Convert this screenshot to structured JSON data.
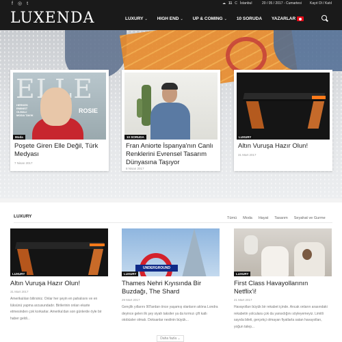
{
  "topbar": {
    "social": [
      "f",
      "◎",
      "t"
    ],
    "weather": {
      "temp": "11",
      "unit": "C",
      "city": "İstanbul"
    },
    "date": "20 / 05 / 2017 - Cumartesi",
    "auth": "Kayıt Ol / Katıl"
  },
  "nav": {
    "logo": "LUXENDA",
    "items": [
      {
        "label": "LUXURY",
        "has_dropdown": true
      },
      {
        "label": "HIGH END",
        "has_dropdown": true
      },
      {
        "label": "UP & COMING",
        "has_dropdown": true
      },
      {
        "label": "10 SORUDA",
        "has_dropdown": false
      },
      {
        "label": "YAZARLAR",
        "has_dropdown": true
      }
    ],
    "chevron": "⌄",
    "flag": "turkey-flag",
    "search_icon": "search-icon"
  },
  "hero": {
    "cards": [
      {
        "category": "Moda",
        "title": "Poşete Giren Elle Değil, Türk Medyası",
        "date": "7 Nisan 2017",
        "cover_left": "HERKES EMINIST OLMALI MODA TAVIK",
        "cover_right": "ROSIE"
      },
      {
        "category": "10 SORUDA",
        "title": "Fran Aniorte İspanya'nın Canlı Renklerini Evrensel Tasarım Dünyasına Taşıyor",
        "date": "8 Nisan 2017"
      },
      {
        "category": "LUXURY",
        "title": "Altın Vuruşa Hazır Olun!",
        "date": "31 Mart 2017"
      }
    ]
  },
  "section": {
    "title": "LUXURY",
    "filters": [
      "Tümü",
      "Moda",
      "Hayat",
      "Tasarım",
      "Seyahat ve Gurme"
    ],
    "posts": [
      {
        "category": "LUXURY",
        "title": "Altın Vuruşa Hazır Olun!",
        "date": "31 Mart 2017",
        "excerpt": "Amerikalıları bilirsiniz. Onlar her şeyin en pahalısını ve en lüksünü yapma arzusundadır. Birilerinin onları ekarte etmesinden çok korkarlar. Amerika'dan son günlerde öyle bir haber geldi..."
      },
      {
        "category": "LUXURY",
        "title": "Thames Nehri Kıyısında Bir Buzdağı, The Shard",
        "date": "29 Mart 2017",
        "excerpt": "Gençlik yıllarını 90'lardan önce yaşamış olanların aklına Londra deyince gelen ilk şey siyah taksiler ya da kırmızı çift katlı otobüsler olmalı. Doksanlar neslinin büyük...",
        "sign": "UNDERGROUND"
      },
      {
        "category": "LUXURY",
        "title": "First Class Havayollarının Netflix'i!",
        "date": "21 Mart 2017",
        "excerpt": "Havayolları büyük bir rekabet içinde. Ancak onların arasındaki rekabetin yolculara çok da yansıdığını söyleyemeyiz. Limitli sayıda bileti, gerçekçi olmayan fiyatlarla satan havayolları, yoğun talep..."
      }
    ],
    "more_label": "Daha fazla ⌄"
  }
}
